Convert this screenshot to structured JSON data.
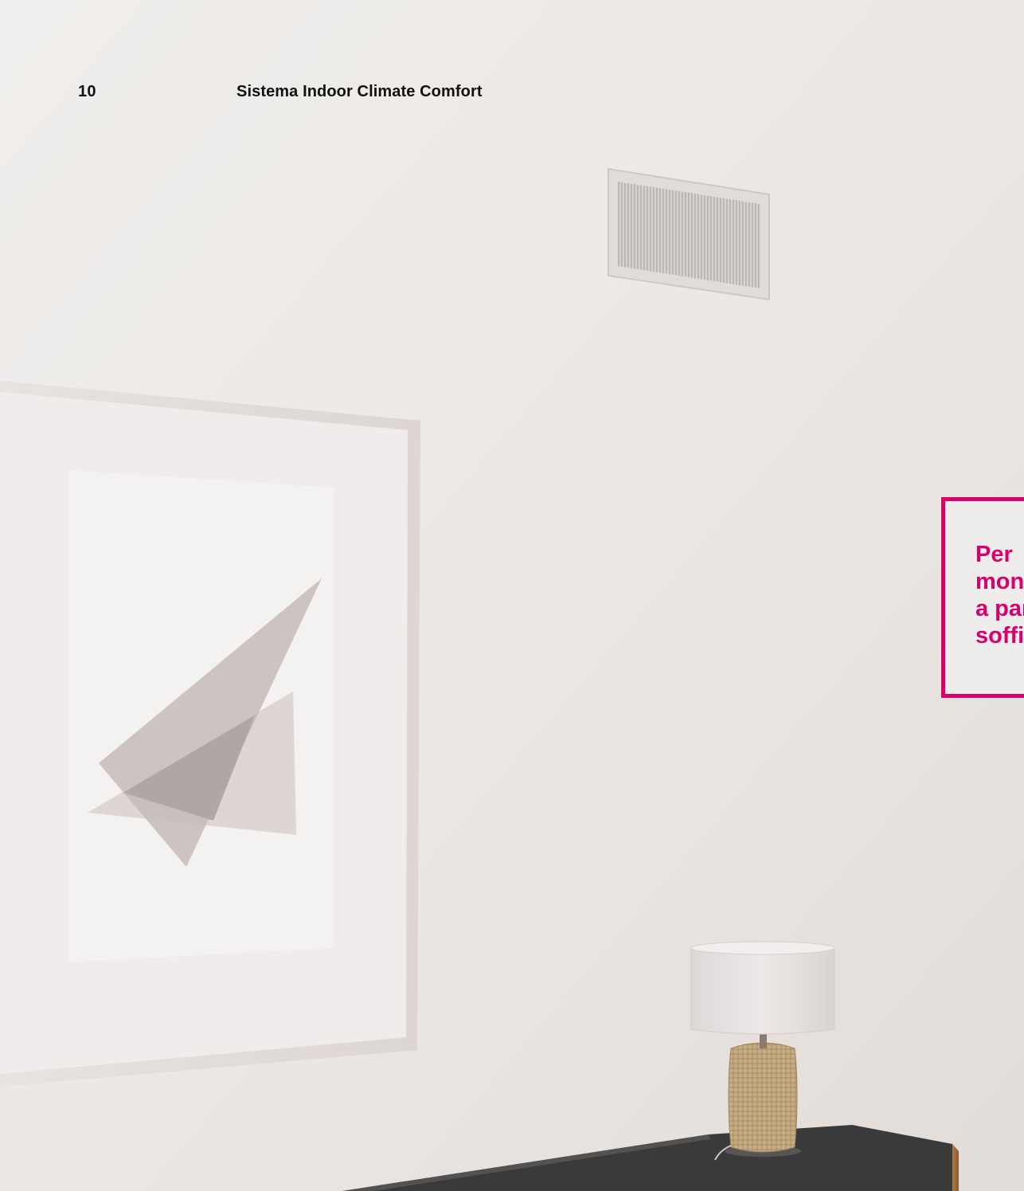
{
  "header": {
    "page_number": "10",
    "title": "Sistema Indoor Climate Comfort"
  },
  "callout": {
    "text": "Per\nmon\na par\nsoffi"
  },
  "colors": {
    "accent": "#d9006c",
    "text": "#111111",
    "wall": "#ebe7e5"
  },
  "icons": {
    "vent": "air-vent-grille-icon",
    "artwork": "framed-abstract-artwork",
    "lamp": "table-lamp"
  }
}
